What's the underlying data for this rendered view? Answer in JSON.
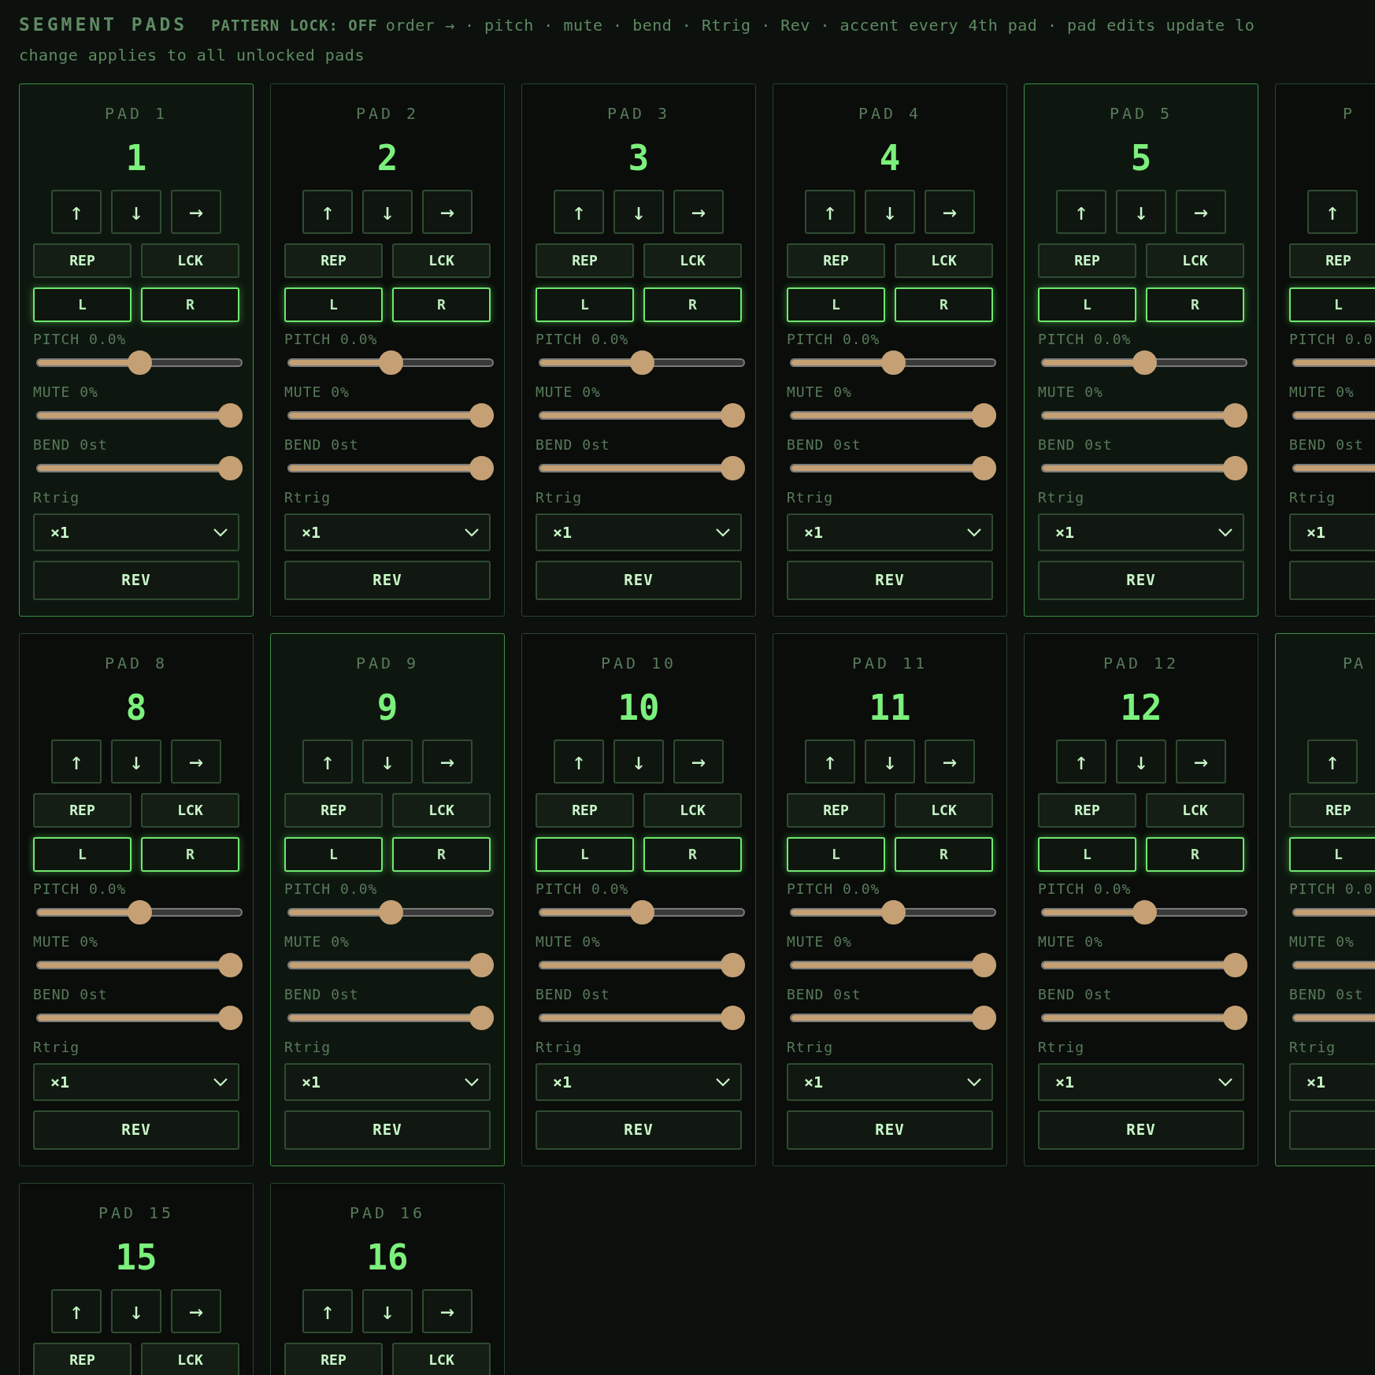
{
  "header": {
    "title": "SEGMENT PADS",
    "lock_status": "PATTERN LOCK: OFF",
    "hint": "order → · pitch · mute · bend · Rtrig · Rev · accent every 4th pad · pad edits update lo",
    "note": "change applies to all unlocked pads"
  },
  "rows": [
    [
      {
        "title": "PAD 1",
        "number": "1",
        "accent": true,
        "moves": [
          "↑",
          "↓",
          "→"
        ],
        "toggles": [
          {
            "label": "REP",
            "on": false
          },
          {
            "label": "LCK",
            "on": false
          }
        ],
        "channels": [
          {
            "label": "L",
            "on": true
          },
          {
            "label": "R",
            "on": true
          }
        ],
        "sliders": [
          {
            "label": "PITCH 0.0%",
            "level": 0.5
          },
          {
            "label": "MUTE 0%",
            "level": 1
          },
          {
            "label": "BEND 0st",
            "level": 1
          }
        ],
        "rtrig": {
          "label": "Rtrig",
          "value": "×1"
        },
        "rev": "REV"
      },
      {
        "title": "PAD 2",
        "number": "2",
        "accent": false,
        "moves": [
          "↑",
          "↓",
          "→"
        ],
        "toggles": [
          {
            "label": "REP",
            "on": false
          },
          {
            "label": "LCK",
            "on": false
          }
        ],
        "channels": [
          {
            "label": "L",
            "on": true
          },
          {
            "label": "R",
            "on": true
          }
        ],
        "sliders": [
          {
            "label": "PITCH 0.0%",
            "level": 0.5
          },
          {
            "label": "MUTE 0%",
            "level": 1
          },
          {
            "label": "BEND 0st",
            "level": 1
          }
        ],
        "rtrig": {
          "label": "Rtrig",
          "value": "×1"
        },
        "rev": "REV"
      },
      {
        "title": "PAD 3",
        "number": "3",
        "accent": false,
        "moves": [
          "↑",
          "↓",
          "→"
        ],
        "toggles": [
          {
            "label": "REP",
            "on": false
          },
          {
            "label": "LCK",
            "on": false
          }
        ],
        "channels": [
          {
            "label": "L",
            "on": true
          },
          {
            "label": "R",
            "on": true
          }
        ],
        "sliders": [
          {
            "label": "PITCH 0.0%",
            "level": 0.5
          },
          {
            "label": "MUTE 0%",
            "level": 1
          },
          {
            "label": "BEND 0st",
            "level": 1
          }
        ],
        "rtrig": {
          "label": "Rtrig",
          "value": "×1"
        },
        "rev": "REV"
      },
      {
        "title": "PAD 4",
        "number": "4",
        "accent": false,
        "moves": [
          "↑",
          "↓",
          "→"
        ],
        "toggles": [
          {
            "label": "REP",
            "on": false
          },
          {
            "label": "LCK",
            "on": false
          }
        ],
        "channels": [
          {
            "label": "L",
            "on": true
          },
          {
            "label": "R",
            "on": true
          }
        ],
        "sliders": [
          {
            "label": "PITCH 0.0%",
            "level": 0.5
          },
          {
            "label": "MUTE 0%",
            "level": 1
          },
          {
            "label": "BEND 0st",
            "level": 1
          }
        ],
        "rtrig": {
          "label": "Rtrig",
          "value": "×1"
        },
        "rev": "REV"
      },
      {
        "title": "PAD 5",
        "number": "5",
        "accent": true,
        "moves": [
          "↑",
          "↓",
          "→"
        ],
        "toggles": [
          {
            "label": "REP",
            "on": false
          },
          {
            "label": "LCK",
            "on": false
          }
        ],
        "channels": [
          {
            "label": "L",
            "on": true
          },
          {
            "label": "R",
            "on": true
          }
        ],
        "sliders": [
          {
            "label": "PITCH 0.0%",
            "level": 0.5
          },
          {
            "label": "MUTE 0%",
            "level": 1
          },
          {
            "label": "BEND 0st",
            "level": 1
          }
        ],
        "rtrig": {
          "label": "Rtrig",
          "value": "×1"
        },
        "rev": "REV"
      },
      {
        "title": "P",
        "clipped": true,
        "accent": false,
        "moves": [
          "↑"
        ],
        "toggles": [
          {
            "label": "REP",
            "on": false
          }
        ],
        "channels": [
          {
            "label": "L",
            "on": true
          }
        ],
        "sliders": [
          {
            "label": "PITCH 0.0",
            "level": 0.5
          },
          {
            "label": "MUTE 0%",
            "level": 1
          },
          {
            "label": "BEND 0st",
            "level": 1
          }
        ],
        "rtrig": {
          "label": "Rtrig",
          "value": "×1"
        }
      }
    ],
    [
      {
        "title": "PAD 8",
        "number": "8",
        "accent": false,
        "moves": [
          "↑",
          "↓",
          "→"
        ],
        "toggles": [
          {
            "label": "REP",
            "on": false
          },
          {
            "label": "LCK",
            "on": false
          }
        ],
        "channels": [
          {
            "label": "L",
            "on": true
          },
          {
            "label": "R",
            "on": true
          }
        ],
        "sliders": [
          {
            "label": "PITCH 0.0%",
            "level": 0.5
          },
          {
            "label": "MUTE 0%",
            "level": 1
          },
          {
            "label": "BEND 0st",
            "level": 1
          }
        ],
        "rtrig": {
          "label": "Rtrig",
          "value": "×1"
        },
        "rev": "REV"
      },
      {
        "title": "PAD 9",
        "number": "9",
        "accent": true,
        "moves": [
          "↑",
          "↓",
          "→"
        ],
        "toggles": [
          {
            "label": "REP",
            "on": false
          },
          {
            "label": "LCK",
            "on": false
          }
        ],
        "channels": [
          {
            "label": "L",
            "on": true
          },
          {
            "label": "R",
            "on": true
          }
        ],
        "sliders": [
          {
            "label": "PITCH 0.0%",
            "level": 0.5
          },
          {
            "label": "MUTE 0%",
            "level": 1
          },
          {
            "label": "BEND 0st",
            "level": 1
          }
        ],
        "rtrig": {
          "label": "Rtrig",
          "value": "×1"
        },
        "rev": "REV"
      },
      {
        "title": "PAD 10",
        "number": "10",
        "accent": false,
        "moves": [
          "↑",
          "↓",
          "→"
        ],
        "toggles": [
          {
            "label": "REP",
            "on": false
          },
          {
            "label": "LCK",
            "on": false
          }
        ],
        "channels": [
          {
            "label": "L",
            "on": true
          },
          {
            "label": "R",
            "on": true
          }
        ],
        "sliders": [
          {
            "label": "PITCH 0.0%",
            "level": 0.5
          },
          {
            "label": "MUTE 0%",
            "level": 1
          },
          {
            "label": "BEND 0st",
            "level": 1
          }
        ],
        "rtrig": {
          "label": "Rtrig",
          "value": "×1"
        },
        "rev": "REV"
      },
      {
        "title": "PAD 11",
        "number": "11",
        "accent": false,
        "moves": [
          "↑",
          "↓",
          "→"
        ],
        "toggles": [
          {
            "label": "REP",
            "on": false
          },
          {
            "label": "LCK",
            "on": false
          }
        ],
        "channels": [
          {
            "label": "L",
            "on": true
          },
          {
            "label": "R",
            "on": true
          }
        ],
        "sliders": [
          {
            "label": "PITCH 0.0%",
            "level": 0.5
          },
          {
            "label": "MUTE 0%",
            "level": 1
          },
          {
            "label": "BEND 0st",
            "level": 1
          }
        ],
        "rtrig": {
          "label": "Rtrig",
          "value": "×1"
        },
        "rev": "REV"
      },
      {
        "title": "PAD 12",
        "number": "12",
        "accent": false,
        "moves": [
          "↑",
          "↓",
          "→"
        ],
        "toggles": [
          {
            "label": "REP",
            "on": false
          },
          {
            "label": "LCK",
            "on": false
          }
        ],
        "channels": [
          {
            "label": "L",
            "on": true
          },
          {
            "label": "R",
            "on": true
          }
        ],
        "sliders": [
          {
            "label": "PITCH 0.0%",
            "level": 0.5
          },
          {
            "label": "MUTE 0%",
            "level": 1
          },
          {
            "label": "BEND 0st",
            "level": 1
          }
        ],
        "rtrig": {
          "label": "Rtrig",
          "value": "×1"
        },
        "rev": "REV"
      },
      {
        "title": "PA",
        "clipped": true,
        "accent": true,
        "moves": [
          "↑"
        ],
        "toggles": [
          {
            "label": "REP",
            "on": false
          }
        ],
        "channels": [
          {
            "label": "L",
            "on": true
          }
        ],
        "sliders": [
          {
            "label": "PITCH 0.0",
            "level": 0.5
          },
          {
            "label": "MUTE 0%",
            "level": 1
          },
          {
            "label": "BEND 0st",
            "level": 1
          }
        ],
        "rtrig": {
          "label": "Rtrig",
          "value": "×1"
        }
      }
    ],
    [
      {
        "title": "PAD 15",
        "number": "15",
        "accent": false,
        "moves": [
          "↑",
          "↓",
          "→"
        ],
        "toggles": [
          {
            "label": "REP",
            "on": false
          },
          {
            "label": "LCK",
            "on": false
          }
        ]
      },
      {
        "title": "PAD 16",
        "number": "16",
        "accent": false,
        "moves": [
          "↑",
          "↓",
          "→"
        ],
        "toggles": [
          {
            "label": "REP",
            "on": false
          },
          {
            "label": "LCK",
            "on": false
          }
        ]
      }
    ]
  ]
}
